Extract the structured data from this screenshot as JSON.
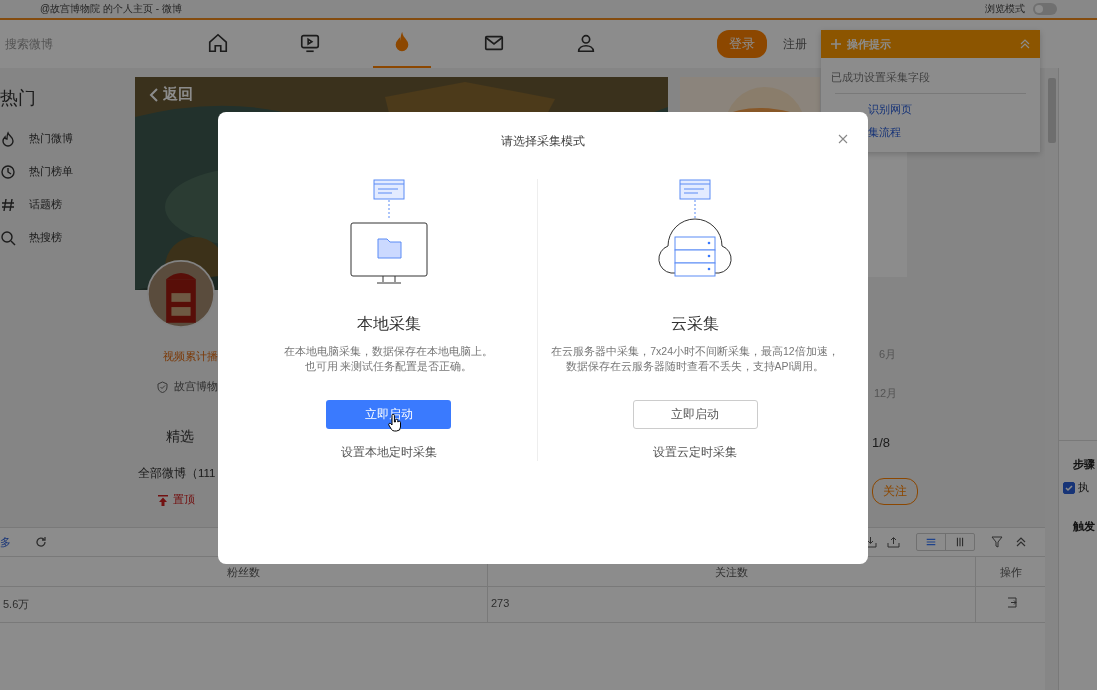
{
  "browser": {
    "tab_title": "@故宫博物院 的个人主页 - 微博",
    "mode_label": "浏览模式",
    "mode_on": false
  },
  "nav": {
    "search_placeholder": "搜索微博",
    "tabs": [
      {
        "kind": "home",
        "selected": false
      },
      {
        "kind": "video",
        "selected": false
      },
      {
        "kind": "fire",
        "selected": true
      },
      {
        "kind": "mail",
        "selected": false
      },
      {
        "kind": "person",
        "selected": false
      }
    ],
    "login": "登录",
    "register": "注册"
  },
  "sidebar": {
    "title": "热门",
    "items": [
      {
        "kind": "fire",
        "label": "热门微博"
      },
      {
        "kind": "clock",
        "label": "热门榜单"
      },
      {
        "kind": "hash",
        "label": "话题榜"
      },
      {
        "kind": "search",
        "label": "热搜榜"
      }
    ]
  },
  "profile": {
    "back": "返回",
    "stat": "视频累计播",
    "verified": "故宫博物",
    "tab": "精选",
    "filter": "全部微博（111",
    "pin": "置顶"
  },
  "right_column": {
    "dates": [
      "6月",
      "12月"
    ],
    "pager": "1/8",
    "follow": "关注"
  },
  "tips": {
    "title": "操作提示",
    "message": "已成功设置采集字段",
    "links": [
      "识别网页",
      "集流程"
    ]
  },
  "table": {
    "toolbar_link": "多",
    "view_modes": [
      {
        "kind": "list",
        "selected": true
      },
      {
        "kind": "columns",
        "selected": false
      }
    ],
    "columns": [
      "粉丝数",
      "关注数",
      "操作"
    ],
    "rows": [
      [
        "5.6万",
        "273"
      ]
    ]
  },
  "side_panel": {
    "heading": "步骤",
    "checkbox": {
      "label": "执",
      "checked": true
    },
    "heading_2": "触发"
  },
  "modal": {
    "title": "请选择采集模式",
    "options": [
      {
        "kind": "local",
        "title": "本地采集",
        "description": [
          "在本地电脑采集，数据保存在本地电脑上。",
          "也可用 来测试任务配置是否正确。"
        ],
        "button": {
          "label": "立即启动",
          "primary": true,
          "hovered": true
        },
        "link": "设置本地定时采集"
      },
      {
        "kind": "cloud",
        "title": "云采集",
        "description": [
          "在云服务器中采集，7x24小时不间断采集，最高12倍加速，",
          "数据保存在云服务器随时查看不丢失，支持API调用。"
        ],
        "button": {
          "label": "立即启动",
          "primary": false,
          "hovered": false
        },
        "link": "设置云定时采集"
      }
    ]
  }
}
